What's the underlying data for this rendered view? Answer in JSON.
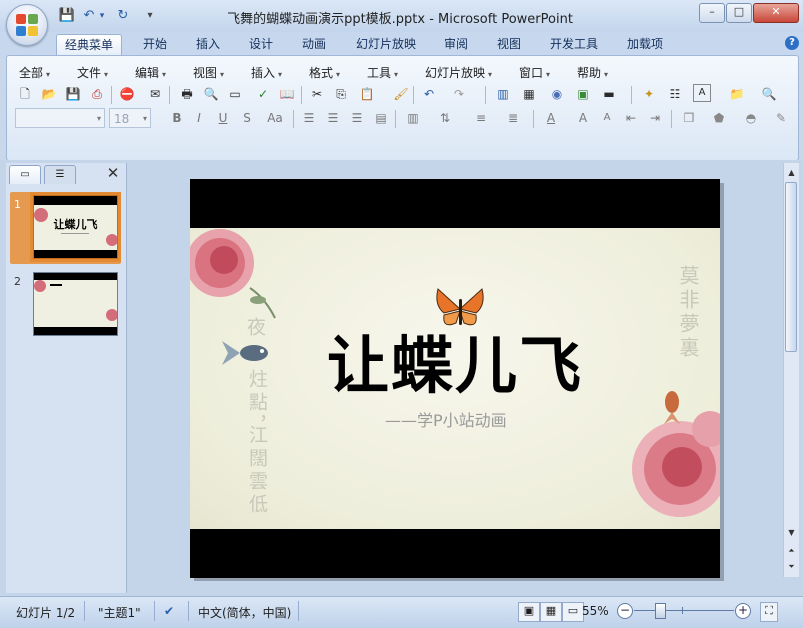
{
  "window": {
    "title": "飞舞的蝴蝶动画演示ppt模板.pptx - Microsoft PowerPoint",
    "min": "–",
    "max": "□",
    "close": "✕"
  },
  "qat": {
    "save": "💾",
    "undo": "↶",
    "undo_arrow": "▾",
    "redo": "↻",
    "customize": "▾"
  },
  "tabs": [
    "经典菜单",
    "开始",
    "插入",
    "设计",
    "动画",
    "幻灯片放映",
    "审阅",
    "视图",
    "开发工具",
    "加载项"
  ],
  "help": "?",
  "menus": [
    "全部",
    "文件",
    "编辑",
    "视图",
    "插入",
    "格式",
    "工具",
    "幻灯片放映",
    "窗口",
    "帮助"
  ],
  "toolbar_row1": [
    "new-doc-icon",
    "open-folder-icon",
    "save-icon",
    "save-pdf-icon",
    "permission-icon",
    "email-icon",
    "print-icon",
    "print-preview-icon",
    "spelling-icon",
    "research-icon",
    "cut-icon",
    "copy-icon",
    "paste-icon",
    "format-painter-icon",
    "undo-icon",
    "redo-icon",
    "chart-icon",
    "table-icon",
    "clipart-icon",
    "picture-icon",
    "textbox-icon",
    "new-slide-icon",
    "layout-icon",
    "text-color-icon",
    "folder-icon",
    "find-icon"
  ],
  "font": {
    "name": "",
    "size": "18"
  },
  "format_buttons": {
    "bold": "B",
    "italic": "I",
    "underline": "U",
    "shadow": "S",
    "case": "Aa"
  },
  "left_pane": {
    "close": "✕"
  },
  "thumbnails": [
    {
      "number": "1",
      "title": "让蝶儿飞",
      "selected": true
    },
    {
      "number": "2",
      "title": "",
      "selected": false
    }
  ],
  "slide": {
    "title": "让蝶儿飞",
    "subtitle": "——学P小站动画",
    "left_poem": [
      "夜",
      "炷點，",
      "江闊雲低"
    ],
    "right_poem": [
      "莫非夢裏"
    ]
  },
  "status": {
    "slide_counter": "幻灯片 1/2",
    "theme": "\"主题1\"",
    "language": "中文(简体，中国)",
    "zoom": "55%",
    "zoom_out": "−",
    "zoom_in": "+"
  },
  "colors": {
    "accent": "#e38a34",
    "ribbon": "#dbe7f5",
    "title_bar": "#c3d5ec"
  }
}
